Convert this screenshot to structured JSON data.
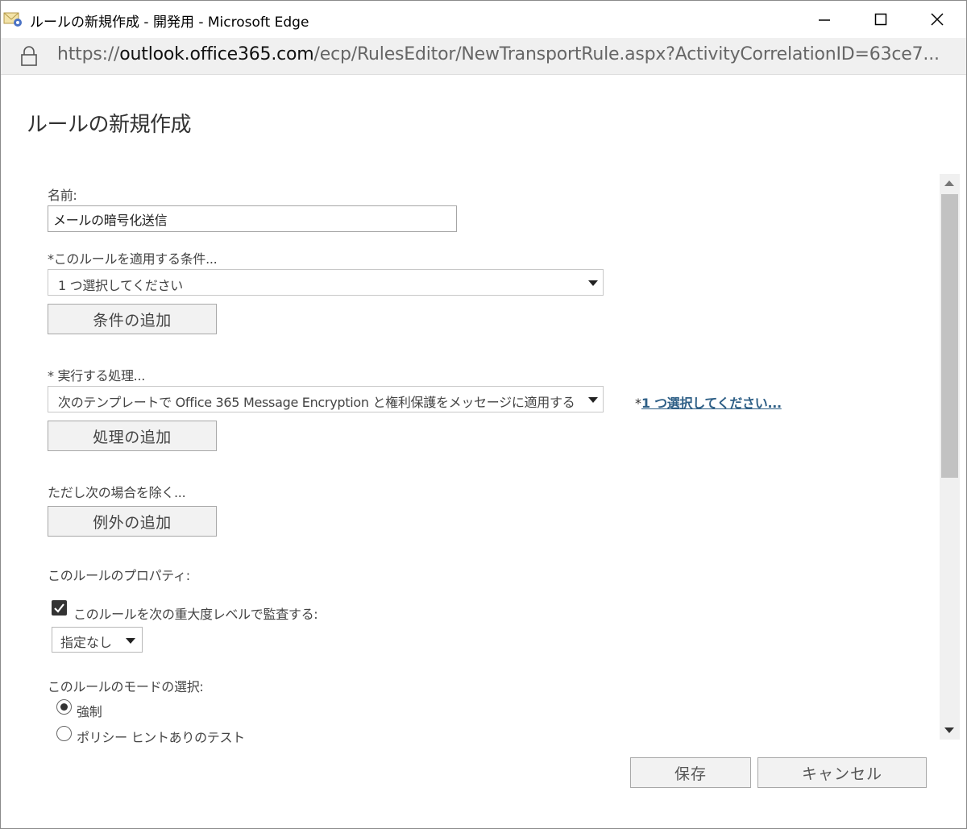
{
  "window": {
    "title": "ルールの新規作成 - 開発用 - Microsoft Edge",
    "url_prefix": "https://",
    "url_host": "outlook.office365.com",
    "url_path": "/ecp/RulesEditor/NewTransportRule.aspx?ActivityCorrelationID=63ce7..."
  },
  "page": {
    "title": "ルールの新規作成"
  },
  "form": {
    "name_label": "名前:",
    "name_value": "メールの暗号化送信",
    "condition_label": "*このルールを適用する条件...",
    "condition_select": "1 つ選択してください",
    "add_condition": "条件の追加",
    "action_label": "* 実行する処理...",
    "action_select": "次のテンプレートで Office 365 Message Encryption と権利保護をメッセージに適用する",
    "action_param_asterisk": "*",
    "action_param_link": "1 つ選択してください...",
    "add_action": "処理の追加",
    "exception_label": "ただし次の場合を除く...",
    "add_exception": "例外の追加",
    "properties_label": "このルールのプロパティ:",
    "audit_label": "このルールを次の重大度レベルで監査する:",
    "audit_checked": true,
    "severity_select": "指定なし",
    "mode_label": "このルールのモードの選択:",
    "mode_options": [
      {
        "label": "強制",
        "checked": true
      },
      {
        "label": "ポリシー ヒントありのテスト",
        "checked": false
      }
    ]
  },
  "footer": {
    "save": "保存",
    "cancel": "キャンセル"
  },
  "colors": {
    "link": "#2e5f86",
    "button_bg": "#f2f2f2",
    "scroll_thumb": "#c2c2c2"
  }
}
